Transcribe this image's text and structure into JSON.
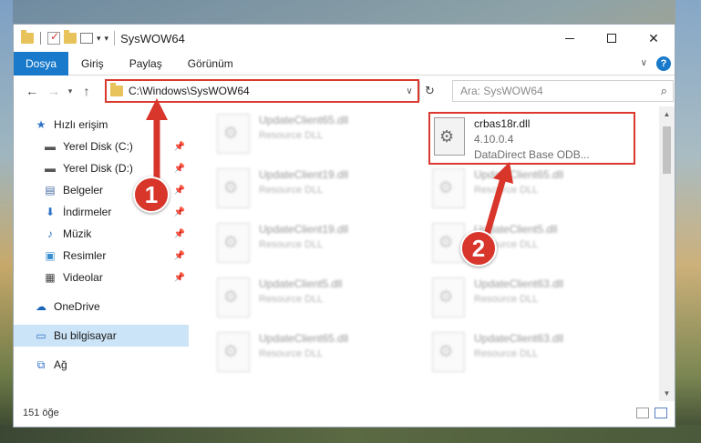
{
  "window": {
    "title": "SysWOW64"
  },
  "ribbon": {
    "tabs": [
      {
        "label": "Dosya",
        "active": true
      },
      {
        "label": "Giriş",
        "active": false
      },
      {
        "label": "Paylaş",
        "active": false
      },
      {
        "label": "Görünüm",
        "active": false
      }
    ],
    "help_label": "?"
  },
  "navbar": {
    "address": "C:\\Windows\\SysWOW64",
    "search_placeholder": "Ara: SysWOW64"
  },
  "sidebar": {
    "items": [
      {
        "label": "Hızlı erişim",
        "icon": "star-icon"
      },
      {
        "label": "Yerel Disk (C:)",
        "icon": "drive-icon"
      },
      {
        "label": "Yerel Disk (D:)",
        "icon": "drive-icon"
      },
      {
        "label": "Belgeler",
        "icon": "documents-icon"
      },
      {
        "label": "İndirmeler",
        "icon": "download-icon"
      },
      {
        "label": "Müzik",
        "icon": "music-icon"
      },
      {
        "label": "Resimler",
        "icon": "pictures-icon"
      },
      {
        "label": "Videolar",
        "icon": "video-icon"
      },
      {
        "label": "OneDrive",
        "icon": "cloud-icon"
      },
      {
        "label": "Bu bilgisayar",
        "icon": "computer-icon"
      },
      {
        "label": "Ağ",
        "icon": "network-icon"
      }
    ]
  },
  "files": {
    "highlighted": {
      "name": "crbas18r.dll",
      "version": "4.10.0.4",
      "description": "DataDirect Base ODB..."
    },
    "left_column": [
      {
        "name": "UpdateClient65.dll",
        "type": "Resource DLL"
      },
      {
        "name": "UpdateClient19.dll",
        "type": "Resource DLL"
      },
      {
        "name": "UpdateClient19.dll",
        "type": "Resource DLL"
      },
      {
        "name": "UpdateClient5.dll",
        "type": "Resource DLL"
      },
      {
        "name": "UpdateClient65.dll",
        "type": "Resource DLL"
      }
    ],
    "right_column": [
      {
        "name": "UpdateClient65.dll",
        "type": "Resource DLL"
      },
      {
        "name": "UpdateClient5.dll",
        "type": "Resource DLL"
      },
      {
        "name": "UpdateClient63.dll",
        "type": "Resource DLL"
      },
      {
        "name": "UpdateClient63.dll",
        "type": "Resource DLL"
      }
    ]
  },
  "status": {
    "item_count": "151 öğe"
  },
  "annotations": {
    "step1": "1",
    "step2": "2",
    "color": "#d8352b"
  }
}
